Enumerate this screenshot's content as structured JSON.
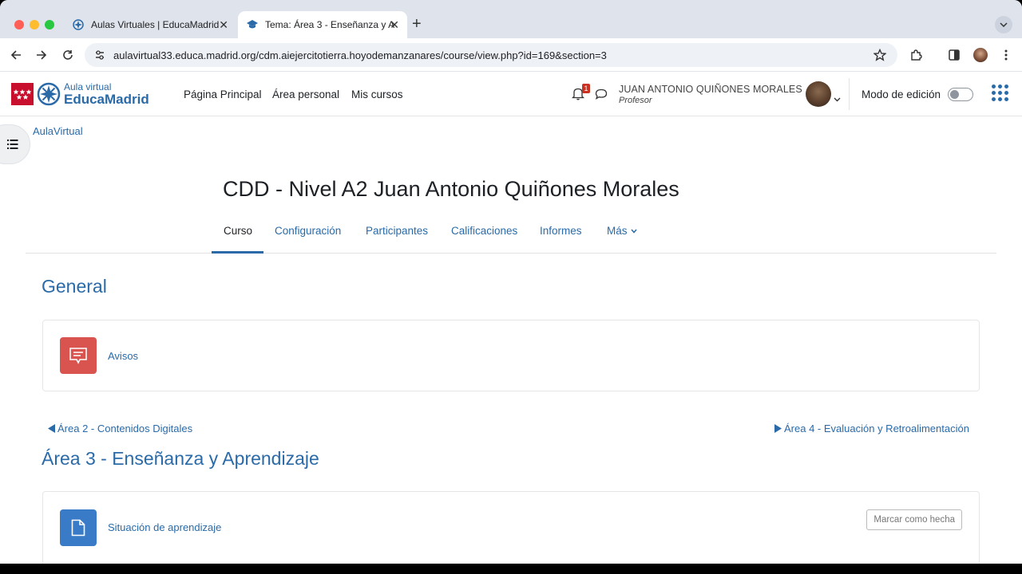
{
  "browser": {
    "tabs": [
      {
        "title": "Aulas Virtuales | EducaMadrid"
      },
      {
        "title": "Tema: Área 3 - Enseñanza y A"
      }
    ],
    "url": "aulavirtual33.educa.madrid.org/cdm.aiejercitotierra.hoyodemanzanares/course/view.php?id=169&section=3"
  },
  "site": {
    "logo_small": "Aula virtual",
    "logo_big": "EducaMadrid",
    "nav": [
      "Página Principal",
      "Área personal",
      "Mis cursos"
    ],
    "notification_count": "1",
    "user_name": "JUAN ANTONIO QUIÑONES MORALES",
    "user_role": "Profesor",
    "edit_mode_label": "Modo de edición",
    "edit_mode_on": false
  },
  "breadcrumb": "AulaVirtual",
  "course": {
    "title": "CDD - Nivel A2 Juan Antonio Quiñones Morales",
    "tabs": [
      "Curso",
      "Configuración",
      "Participantes",
      "Calificaciones",
      "Informes",
      "Más"
    ],
    "active_tab": "Curso"
  },
  "sections": {
    "general": {
      "title": "General",
      "activities": [
        {
          "label": "Avisos",
          "type": "forum",
          "color": "#d9534f"
        }
      ]
    },
    "prev_link": "Área 2 - Contenidos Digitales",
    "next_link": "Área 4 - Evaluación y Retroalimentación",
    "area3": {
      "title": "Área 3 - Enseñanza y Aprendizaje",
      "activities": [
        {
          "label": "Situación de aprendizaje",
          "type": "resource",
          "color": "#3a7bc8",
          "action": "Marcar como hecha"
        }
      ]
    }
  }
}
